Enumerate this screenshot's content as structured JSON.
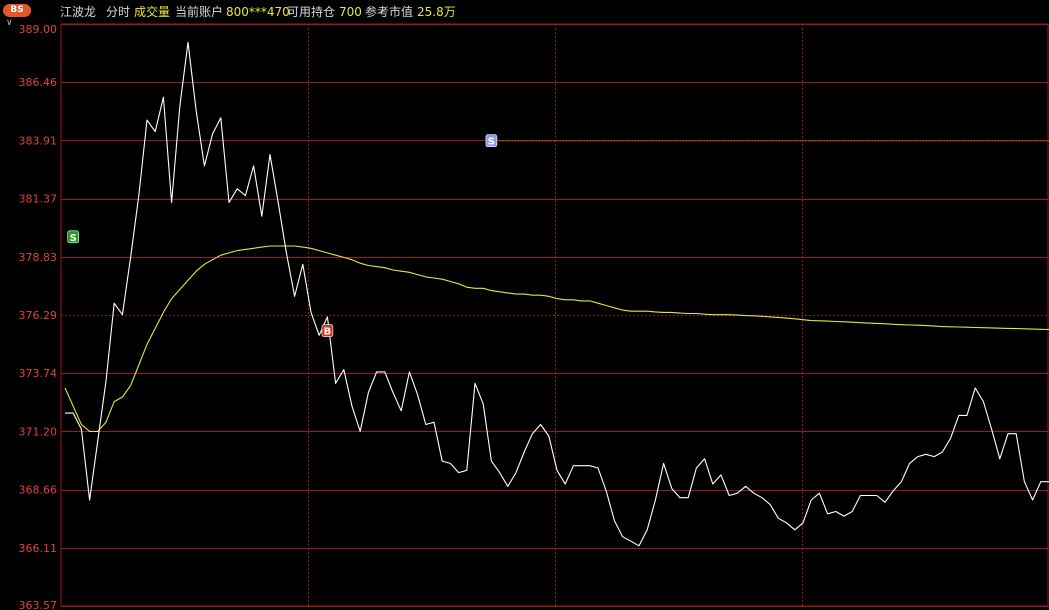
{
  "header": {
    "badge": "BS",
    "stock_name": "江波龙",
    "mode": "分时",
    "volume_label": "成交量",
    "account_label": "当前账户",
    "account_value": "800***470",
    "position_label": "可用持仓",
    "position_value": "700",
    "market_value_label": "参考市值",
    "market_value": "25.8万"
  },
  "colors": {
    "background": "#000000",
    "grid": "#9a1a1a",
    "axis_text": "#e04040",
    "price_line": "#ffffff",
    "avg_line": "#e6e63c",
    "buy_marker": "#d23b2a",
    "sell_marker_green": "#1f9a1f",
    "sell_marker_blue": "#8c9af0"
  },
  "chart_data": {
    "type": "line",
    "ylim": [
      363.57,
      389.0
    ],
    "y_ticks": [
      "389.00",
      "386.46",
      "383.91",
      "381.37",
      "378.83",
      "376.29",
      "373.74",
      "371.20",
      "368.66",
      "366.11",
      "363.57"
    ],
    "x_count": 121,
    "series": [
      {
        "key": "price",
        "values": [
          372.0,
          372.0,
          371.3,
          368.2,
          370.8,
          373.4,
          376.8,
          376.3,
          378.8,
          381.5,
          384.8,
          384.3,
          385.8,
          381.2,
          385.4,
          388.2,
          385.2,
          382.8,
          384.2,
          384.9,
          381.2,
          381.8,
          381.5,
          382.8,
          380.6,
          383.3,
          381.2,
          379.0,
          377.1,
          378.5,
          376.4,
          375.4,
          376.2,
          373.3,
          373.9,
          372.3,
          371.2,
          372.9,
          373.8,
          373.8,
          372.9,
          372.1,
          373.8,
          372.8,
          371.5,
          371.6,
          369.9,
          369.8,
          369.4,
          369.5,
          373.3,
          372.4,
          369.9,
          369.4,
          368.8,
          369.4,
          370.3,
          371.1,
          371.5,
          371.0,
          369.5,
          368.9,
          369.7,
          369.7,
          369.7,
          369.6,
          368.6,
          367.3,
          366.6,
          366.4,
          366.2,
          366.9,
          368.2,
          369.8,
          368.7,
          368.3,
          368.3,
          369.6,
          370.0,
          368.9,
          369.3,
          368.4,
          368.5,
          368.8,
          368.5,
          368.3,
          368.0,
          367.4,
          367.2,
          366.9,
          367.2,
          368.2,
          368.5,
          367.6,
          367.7,
          367.5,
          367.7,
          368.4,
          368.4,
          368.4,
          368.1,
          368.6,
          369.0,
          369.8,
          370.1,
          370.2,
          370.1,
          370.3,
          370.9,
          371.9,
          371.9,
          373.1,
          372.5,
          371.3,
          370.0,
          371.1,
          371.1,
          369.0,
          368.2,
          369.0,
          369.0
        ],
        "color": "#ffffff"
      },
      {
        "key": "avg",
        "values": [
          373.1,
          372.3,
          371.5,
          371.2,
          371.2,
          371.6,
          372.5,
          372.7,
          373.2,
          374.1,
          375.0,
          375.7,
          376.4,
          377.0,
          377.4,
          377.8,
          378.2,
          378.5,
          378.7,
          378.9,
          379.0,
          379.1,
          379.15,
          379.2,
          379.25,
          379.3,
          379.3,
          379.3,
          379.3,
          379.25,
          379.2,
          379.1,
          379.0,
          378.9,
          378.8,
          378.7,
          378.55,
          378.45,
          378.4,
          378.35,
          378.25,
          378.2,
          378.15,
          378.05,
          377.95,
          377.9,
          377.85,
          377.75,
          377.65,
          377.5,
          377.45,
          377.45,
          377.35,
          377.3,
          377.25,
          377.2,
          377.2,
          377.15,
          377.15,
          377.1,
          377.0,
          376.95,
          376.95,
          376.9,
          376.9,
          376.8,
          376.7,
          376.6,
          376.5,
          376.45,
          376.45,
          376.45,
          376.42,
          376.4,
          376.4,
          376.37,
          376.35,
          376.35,
          376.32,
          376.3,
          376.3,
          376.3,
          376.28,
          376.26,
          376.25,
          376.23,
          376.2,
          376.18,
          376.15,
          376.12,
          376.08,
          376.04,
          376.03,
          376.02,
          376.0,
          375.99,
          375.97,
          375.95,
          375.93,
          375.92,
          375.9,
          375.88,
          375.86,
          375.85,
          375.84,
          375.82,
          375.8,
          375.78,
          375.77,
          375.76,
          375.75,
          375.74,
          375.73,
          375.72,
          375.71,
          375.7,
          375.69,
          375.68,
          375.67,
          375.66,
          375.65
        ],
        "color": "#e6e63c"
      }
    ],
    "markers": [
      {
        "label": "S",
        "type": "sell",
        "x_index": 1,
        "price": 379.7,
        "color": "#1f9a1f"
      },
      {
        "label": "B",
        "type": "buy",
        "x_index": 32,
        "price": 375.6,
        "color": "#d23b2a"
      },
      {
        "label": "S",
        "type": "sell",
        "x_index": 52,
        "price": 383.9,
        "color": "#8c9af0"
      }
    ],
    "reference_line": {
      "price": 383.91,
      "from_x_index": 53
    }
  }
}
